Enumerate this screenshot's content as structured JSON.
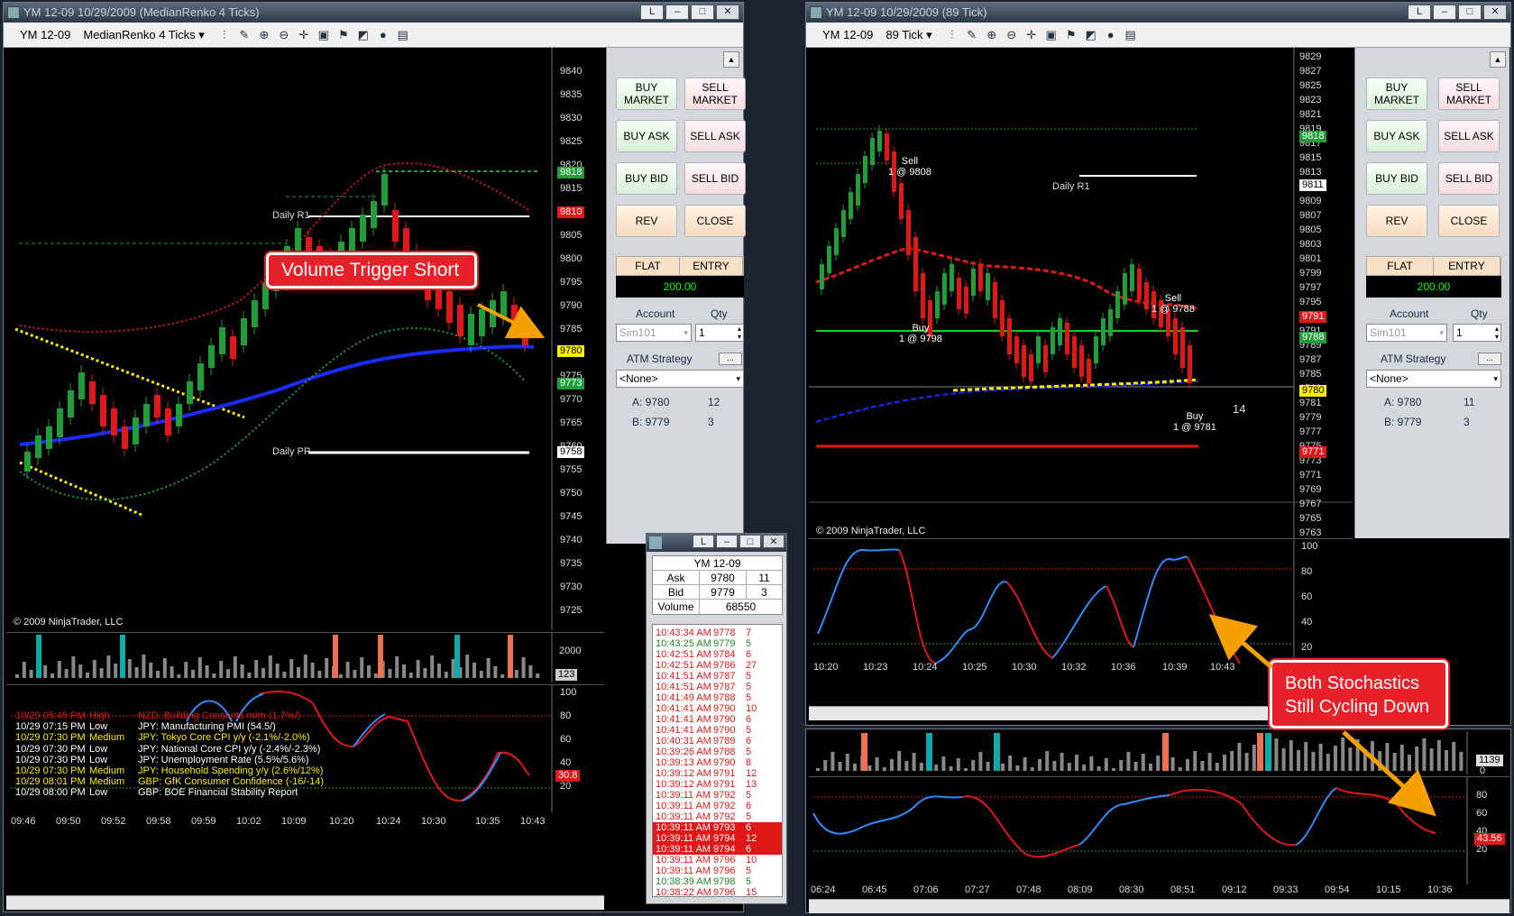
{
  "left_window": {
    "title": "YM 12-09  10/29/2009 (MedianRenko 4 Ticks)",
    "instrument": "YM 12-09",
    "period": "MedianRenko 4 Ticks",
    "copyright": "© 2009 NinjaTrader, LLC",
    "price_labels": [
      "9840",
      "9835",
      "9830",
      "9825",
      "9820",
      "9815",
      "9810",
      "9805",
      "9800",
      "9795",
      "9790",
      "9785",
      "9780",
      "9775",
      "9770",
      "9765",
      "9760",
      "9755",
      "9750",
      "9745",
      "9740",
      "9735",
      "9730",
      "9725"
    ],
    "price_tags": [
      {
        "text": "9818",
        "color": "#1f9e3a"
      },
      {
        "text": "9810",
        "color": "#e01818"
      },
      {
        "text": "9780",
        "color": "#ffee00"
      },
      {
        "text": "9773",
        "color": "#1f9e3a"
      },
      {
        "text": "9758",
        "color": "#ffffff"
      }
    ],
    "daily_r1": "Daily R1",
    "daily_pp": "Daily PP",
    "time_labels": [
      "09:46",
      "09:50",
      "09:52",
      "09:58",
      "09:59",
      "10:02",
      "10:09",
      "10:20",
      "10:24",
      "10:30",
      "10:35",
      "10:43"
    ],
    "volume_labels": [
      "2000",
      "123"
    ],
    "stoch_labels": [
      "100",
      "80",
      "60",
      "40",
      "20"
    ],
    "stoch_tag": "30.8",
    "callout": "Volume Trigger Short",
    "news": [
      {
        "time": "10/29 05:45 PM",
        "impact": "High",
        "event": "NZD: Building Consents m/m (1.7%/)",
        "color": "#e01818"
      },
      {
        "time": "10/29 07:15 PM",
        "impact": "Low",
        "event": "JPY: Manufacturing PMI (54.5/)",
        "color": "#ffffff"
      },
      {
        "time": "10/29 07:30 PM",
        "impact": "Medium",
        "event": "JPY: Tokyo Core CPI y/y (-2.1%/-2.0%)",
        "color": "#ffee00"
      },
      {
        "time": "10/29 07:30 PM",
        "impact": "Low",
        "event": "JPY: National Core CPI y/y (-2.4%/-2.3%)",
        "color": "#ffffff"
      },
      {
        "time": "10/29 07:30 PM",
        "impact": "Low",
        "event": "JPY: Unemployment Rate (5.5%/5.6%)",
        "color": "#ffffff"
      },
      {
        "time": "10/29 07:30 PM",
        "impact": "Medium",
        "event": "JPY: Household Spending y/y (2.6%/12%)",
        "color": "#ffee00"
      },
      {
        "time": "10/29 08:01 PM",
        "impact": "Medium",
        "event": "GBP: GfK Consumer Confidence (-16/-14)",
        "color": "#ffee00"
      },
      {
        "time": "10/29 08:00 PM",
        "impact": "Low",
        "event": "GBP: BOE Financial Stability Report",
        "color": "#ffffff"
      }
    ]
  },
  "right_window": {
    "title": "YM 12-09  10/29/2009 (89 Tick)",
    "instrument": "YM 12-09",
    "period": "89 Tick",
    "copyright": "© 2009 NinjaTrader, LLC",
    "price_labels": [
      "9829",
      "9827",
      "9825",
      "9823",
      "9821",
      "9819",
      "9817",
      "9815",
      "9813",
      "9811",
      "9809",
      "9807",
      "9805",
      "9803",
      "9801",
      "9799",
      "9797",
      "9795",
      "9793",
      "9791",
      "9789",
      "9787",
      "9785",
      "9783",
      "9781",
      "9779",
      "9777",
      "9775",
      "9773",
      "9771",
      "9769",
      "9767",
      "9765",
      "9763"
    ],
    "price_tags": [
      {
        "text": "9818",
        "color": "#1f9e3a"
      },
      {
        "text": "9811",
        "color": "#ffffff"
      },
      {
        "text": "9791",
        "color": "#e01818"
      },
      {
        "text": "9788",
        "color": "#1f9e3a"
      },
      {
        "text": "9780",
        "color": "#ffee00"
      },
      {
        "text": "9771",
        "color": "#e01818"
      }
    ],
    "daily_r1": "Daily R1",
    "qty_label": "14",
    "trades": [
      {
        "label": "Sell",
        "detail": "1 @ 9808"
      },
      {
        "label": "Buy",
        "detail": "1 @ 9798"
      },
      {
        "label": "Sell",
        "detail": "1 @ 9788"
      },
      {
        "label": "Buy",
        "detail": "1 @ 9781"
      }
    ],
    "time_labels": [
      "10:20",
      "10:23",
      "10:24",
      "10:25",
      "10:30",
      "10:32",
      "10:36",
      "10:39",
      "10:43"
    ],
    "stoch_labels": [
      "100",
      "80",
      "60",
      "40",
      "20"
    ],
    "bottom_time_labels": [
      "06:24",
      "06:45",
      "07:06",
      "07:27",
      "07:48",
      "08:09",
      "08:30",
      "08:51",
      "09:12",
      "09:33",
      "09:54",
      "10:15",
      "10:36"
    ],
    "bottom_volume_labels": [
      "1139",
      "0"
    ],
    "bottom_stoch_labels": [
      "80",
      "60",
      "40",
      "20"
    ],
    "bottom_stoch_tag": "43.56",
    "callout_line1": "Both Stochastics",
    "callout_line2": "Still Cycling Down"
  },
  "order_panel": {
    "buy_market": "BUY MARKET",
    "sell_market": "SELL MARKET",
    "buy_ask": "BUY ASK",
    "sell_ask": "SELL ASK",
    "buy_bid": "BUY BID",
    "sell_bid": "SELL BID",
    "rev": "REV",
    "close": "CLOSE",
    "flat": "FLAT",
    "entry": "ENTRY",
    "pnl": "200.00",
    "account_label": "Account",
    "qty_label": "Qty",
    "account": "Sim101",
    "qty": "1",
    "atm_label": "ATM Strategy",
    "atm_value": "<None>",
    "ask_line": "A: 9780",
    "ask_size": "12",
    "bid_line": "B: 9779",
    "bid_size": "3",
    "right_ask_size": "11",
    "right_bid_size": "3"
  },
  "time_sales": {
    "title": "YM 12-09",
    "ask_label": "Ask",
    "ask": "9780",
    "ask_size": "11",
    "bid_label": "Bid",
    "bid": "9779",
    "bid_size": "3",
    "volume_label": "Volume",
    "volume": "68550",
    "rows": [
      {
        "t": "10:43:34 AM",
        "p": "9778",
        "s": "7",
        "c": "#e01818",
        "bg": ""
      },
      {
        "t": "10:43:25 AM",
        "p": "9779",
        "s": "5",
        "c": "#1f8a2a",
        "bg": ""
      },
      {
        "t": "10:42:51 AM",
        "p": "9784",
        "s": "6",
        "c": "#e01818",
        "bg": ""
      },
      {
        "t": "10:42:51 AM",
        "p": "9786",
        "s": "27",
        "c": "#e01818",
        "bg": ""
      },
      {
        "t": "10:41:51 AM",
        "p": "9787",
        "s": "5",
        "c": "#e01818",
        "bg": ""
      },
      {
        "t": "10:41:51 AM",
        "p": "9787",
        "s": "5",
        "c": "#e01818",
        "bg": ""
      },
      {
        "t": "10:41:49 AM",
        "p": "9788",
        "s": "5",
        "c": "#e01818",
        "bg": ""
      },
      {
        "t": "10:41:41 AM",
        "p": "9790",
        "s": "10",
        "c": "#e01818",
        "bg": ""
      },
      {
        "t": "10:41:41 AM",
        "p": "9790",
        "s": "6",
        "c": "#e01818",
        "bg": ""
      },
      {
        "t": "10:41:41 AM",
        "p": "9790",
        "s": "5",
        "c": "#e01818",
        "bg": ""
      },
      {
        "t": "10:40:31 AM",
        "p": "9789",
        "s": "6",
        "c": "#e01818",
        "bg": ""
      },
      {
        "t": "10:39:26 AM",
        "p": "9788",
        "s": "5",
        "c": "#e01818",
        "bg": ""
      },
      {
        "t": "10:39:13 AM",
        "p": "9790",
        "s": "8",
        "c": "#e01818",
        "bg": ""
      },
      {
        "t": "10:39:12 AM",
        "p": "9791",
        "s": "12",
        "c": "#e01818",
        "bg": ""
      },
      {
        "t": "10:39:12 AM",
        "p": "9791",
        "s": "13",
        "c": "#e01818",
        "bg": ""
      },
      {
        "t": "10:39:11 AM",
        "p": "9792",
        "s": "5",
        "c": "#e01818",
        "bg": ""
      },
      {
        "t": "10:39:11 AM",
        "p": "9792",
        "s": "6",
        "c": "#e01818",
        "bg": ""
      },
      {
        "t": "10:39:11 AM",
        "p": "9792",
        "s": "5",
        "c": "#e01818",
        "bg": ""
      },
      {
        "t": "10:39:11 AM",
        "p": "9793",
        "s": "6",
        "c": "#ffffff",
        "bg": "#e01818"
      },
      {
        "t": "10:39:11 AM",
        "p": "9794",
        "s": "12",
        "c": "#ffffff",
        "bg": "#e01818"
      },
      {
        "t": "10:39:11 AM",
        "p": "9794",
        "s": "6",
        "c": "#ffffff",
        "bg": "#e01818"
      },
      {
        "t": "10:39:11 AM",
        "p": "9796",
        "s": "10",
        "c": "#e01818",
        "bg": ""
      },
      {
        "t": "10:39:11 AM",
        "p": "9796",
        "s": "5",
        "c": "#e01818",
        "bg": ""
      },
      {
        "t": "10:38:39 AM",
        "p": "9798",
        "s": "5",
        "c": "#1f8a2a",
        "bg": ""
      },
      {
        "t": "10:38:22 AM",
        "p": "9796",
        "s": "15",
        "c": "#e01818",
        "bg": ""
      }
    ]
  },
  "colors": {
    "ma": "#1a2cff",
    "stoch_up": "#2f8cff",
    "stoch_down": "#e01818",
    "bull": "#1f9e3a",
    "bear": "#e01818"
  }
}
